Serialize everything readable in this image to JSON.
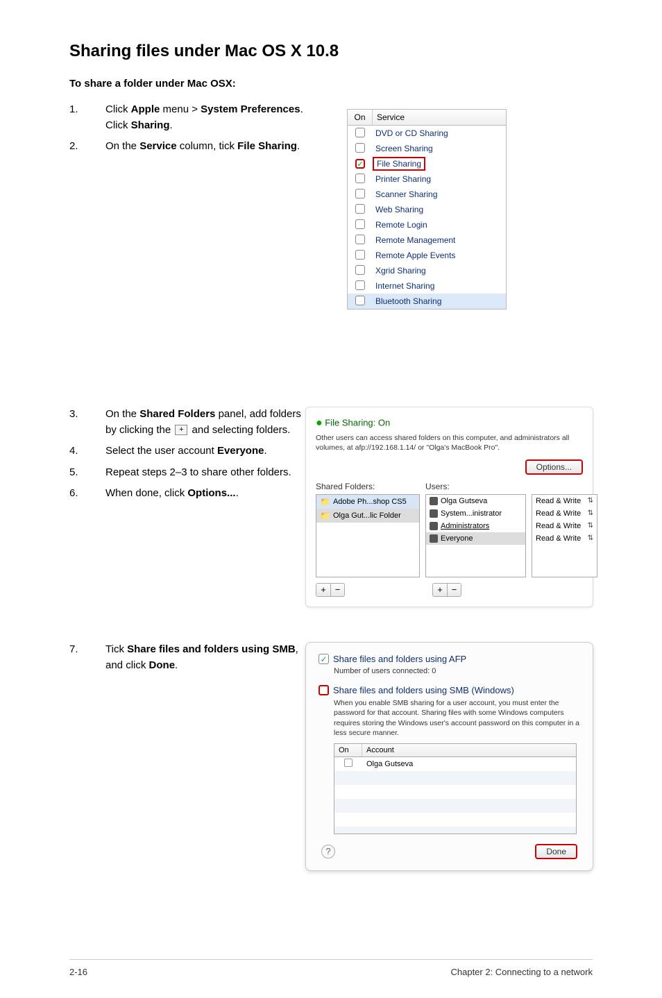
{
  "heading": "Sharing files under Mac OS X 10.8",
  "subheading": "To share a folder under Mac OSX:",
  "steps_a": [
    {
      "num": "1.",
      "html": "Click <b>Apple</b> menu > <b>System Preferences</b>. Click <b>Sharing</b>."
    },
    {
      "num": "2.",
      "html": "On the <b>Service</b> column, tick <b>File Sharing</b>."
    }
  ],
  "svc_header": {
    "on": "On",
    "service": "Service"
  },
  "services": [
    {
      "name": "DVD or CD Sharing",
      "checked": false
    },
    {
      "name": "Screen Sharing",
      "checked": false
    },
    {
      "name": "File Sharing",
      "checked": true,
      "redbox": true
    },
    {
      "name": "Printer Sharing",
      "checked": false
    },
    {
      "name": "Scanner Sharing",
      "checked": false
    },
    {
      "name": "Web Sharing",
      "checked": false
    },
    {
      "name": "Remote Login",
      "checked": false
    },
    {
      "name": "Remote Management",
      "checked": false
    },
    {
      "name": "Remote Apple Events",
      "checked": false
    },
    {
      "name": "Xgrid Sharing",
      "checked": false
    },
    {
      "name": "Internet Sharing",
      "checked": false
    },
    {
      "name": "Bluetooth Sharing",
      "checked": false,
      "hl": true
    }
  ],
  "steps_b": [
    {
      "num": "3.",
      "html": "On the <b>Shared Folders</b> panel, add folders by clicking the <span class='plusicon'>+</span> and selecting folders."
    },
    {
      "num": "4.",
      "html": "Select the user account <b>Everyone</b>."
    },
    {
      "num": "5.",
      "html": "Repeat steps 2–3 to share other folders."
    },
    {
      "num": "6.",
      "html": "When done, click <b>Options...</b>."
    }
  ],
  "fs": {
    "title": "File Sharing: On",
    "desc": "Other users can access shared folders on this computer, and administrators all volumes, at afp://192.168.1.14/ or \"Olga's MacBook Pro\".",
    "options_btn": "Options...",
    "folders_h": "Shared Folders:",
    "users_h": "Users:",
    "folders": [
      "Adobe Ph...shop CS5",
      "Olga Gut...lic Folder"
    ],
    "users": [
      "Olga Gutseva",
      "System...inistrator",
      "Administrators",
      "Everyone"
    ],
    "perms": [
      "Read & Write",
      "Read & Write",
      "Read & Write",
      "Read & Write"
    ]
  },
  "steps_c": [
    {
      "num": "7.",
      "html": "Tick <b>Share files and folders using SMB</b>, and click <b>Done</b>."
    }
  ],
  "smb": {
    "afp_label": "Share files and folders using AFP",
    "afp_sub": "Number of users connected: 0",
    "smb_label": "Share files and folders using SMB (Windows)",
    "note": "When you enable SMB sharing for a user account, you must enter the password for that account. Sharing files with some Windows computers requires storing the Windows user's account password on this computer in a less secure manner.",
    "th_on": "On",
    "th_account": "Account",
    "accounts": [
      "Olga Gutseva"
    ],
    "done": "Done"
  },
  "footer": {
    "left": "2-16",
    "right": "Chapter 2: Connecting to a network"
  }
}
